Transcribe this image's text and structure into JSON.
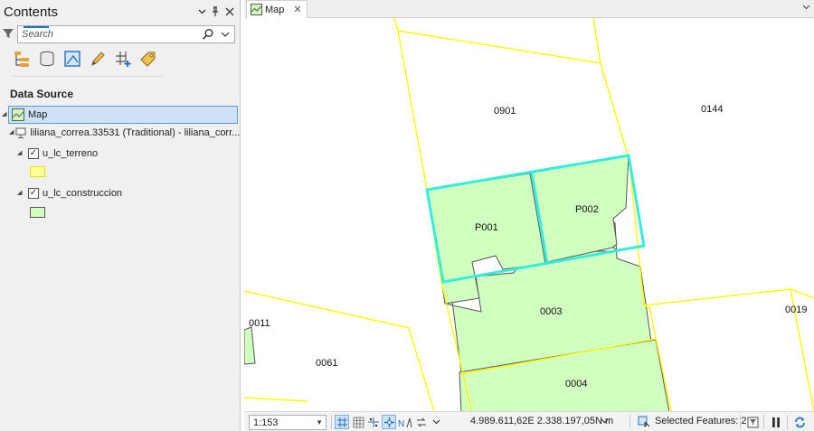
{
  "contents": {
    "title": "Contents",
    "search": {
      "placeholder": "Search"
    },
    "section_title": "Data Source",
    "tree": {
      "map": "Map",
      "datasource": "liliana_correa.33531 (Traditional) - liliana_corr...",
      "layer1": {
        "name": "u_lc_terreno",
        "checked": "✓",
        "swatch_color": "#ffff99"
      },
      "layer2": {
        "name": "u_lc_construccion",
        "checked": "✓",
        "swatch_color": "#d1ffbf"
      }
    },
    "toolbar_icons": [
      "list-by-drawing-order-icon",
      "list-by-data-source-icon",
      "list-by-selection-icon",
      "list-by-editing-icon",
      "list-by-snapping-icon",
      "list-by-labeling-icon"
    ]
  },
  "map_view": {
    "tab_label": "Map",
    "parcel_labels": {
      "p0901": "0901",
      "p0144": "0144",
      "pP001": "P001",
      "pP002": "P002",
      "p0003": "0003",
      "p0011": "0011",
      "p0019": "0019",
      "p0061": "0061",
      "p0004": "0004"
    },
    "colors": {
      "parcel_boundary": "#ffff00",
      "construction_fill": "#d1ffbf",
      "selection": "#33eedd"
    }
  },
  "status_bar": {
    "scale": "1:153",
    "coordinates": "4.989.611,62E 2.338.197,05N m",
    "selected_features": "Selected Features: 2"
  }
}
